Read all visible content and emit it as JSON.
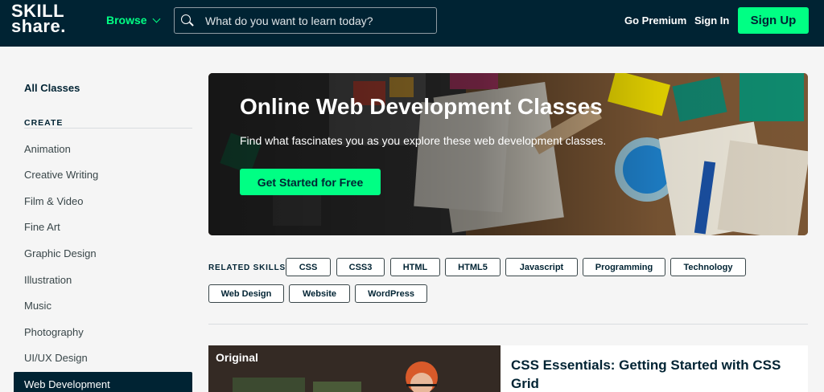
{
  "header": {
    "logo": {
      "line1": "SKILL",
      "line2": "share."
    },
    "browse_label": "Browse",
    "search_placeholder": "What do you want to learn today?",
    "go_premium": "Go Premium",
    "sign_in": "Sign In",
    "sign_up": "Sign Up"
  },
  "sidebar": {
    "all_classes": "All Classes",
    "section_heading": "CREATE",
    "items": [
      {
        "label": "Animation"
      },
      {
        "label": "Creative Writing"
      },
      {
        "label": "Film & Video"
      },
      {
        "label": "Fine Art"
      },
      {
        "label": "Graphic Design"
      },
      {
        "label": "Illustration"
      },
      {
        "label": "Music"
      },
      {
        "label": "Photography"
      },
      {
        "label": "UI/UX Design"
      },
      {
        "label": "Web Development",
        "active": true
      }
    ]
  },
  "hero": {
    "title": "Online Web Development Classes",
    "subtitle": "Find what fascinates you as you explore these web development classes.",
    "cta": "Get Started for Free"
  },
  "related_skills": {
    "label": "RELATED SKILLS",
    "skills": [
      "CSS",
      "CSS3",
      "HTML",
      "HTML5",
      "Javascript",
      "Programming",
      "Technology",
      "Web Design",
      "Website",
      "WordPress"
    ]
  },
  "course": {
    "badge": "Original",
    "title": "CSS Essentials: Getting Started with CSS Grid"
  },
  "colors": {
    "navy": "#002333",
    "accent_green": "#00ff84",
    "background": "#f5f5f5"
  }
}
